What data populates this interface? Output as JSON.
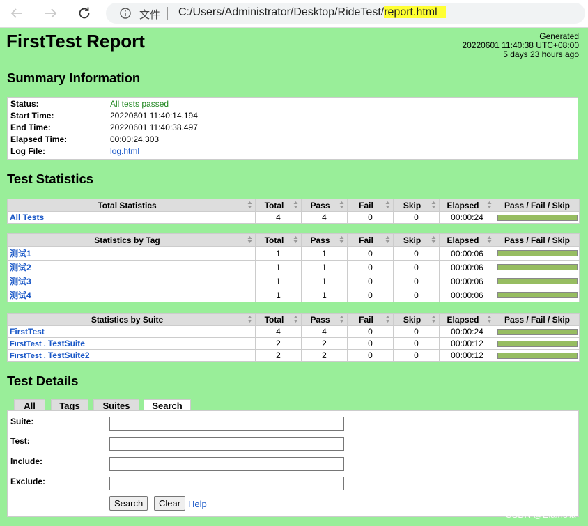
{
  "browser": {
    "url_prefix": "文件",
    "url_path": "C:/Users/Administrator/Desktop/RideTest/",
    "url_file": "report.html"
  },
  "header": {
    "title": "FirstTest Report",
    "generated_label": "Generated",
    "generated_time": "20220601 11:40:38 UTC+08:00",
    "generated_ago": "5 days 23 hours ago"
  },
  "summary": {
    "heading": "Summary Information",
    "rows": [
      {
        "label": "Status:",
        "value": "All tests passed"
      },
      {
        "label": "Start Time:",
        "value": "20220601 11:40:14.194"
      },
      {
        "label": "End Time:",
        "value": "20220601 11:40:38.497"
      },
      {
        "label": "Elapsed Time:",
        "value": "00:00:24.303"
      },
      {
        "label": "Log File:",
        "value": "log.html"
      }
    ]
  },
  "statistics": {
    "heading": "Test Statistics",
    "columns": [
      "Total",
      "Pass",
      "Fail",
      "Skip",
      "Elapsed",
      "Pass / Fail / Skip"
    ],
    "total": {
      "header": "Total Statistics",
      "rows": [
        {
          "name": "All Tests",
          "total": "4",
          "pass": "4",
          "fail": "0",
          "skip": "0",
          "elapsed": "00:00:24",
          "pass_fraction": 1
        }
      ]
    },
    "tag": {
      "header": "Statistics by Tag",
      "rows": [
        {
          "name": "测试1",
          "total": "1",
          "pass": "1",
          "fail": "0",
          "skip": "0",
          "elapsed": "00:00:06",
          "pass_fraction": 1
        },
        {
          "name": "测试2",
          "total": "1",
          "pass": "1",
          "fail": "0",
          "skip": "0",
          "elapsed": "00:00:06",
          "pass_fraction": 1
        },
        {
          "name": "测试3",
          "total": "1",
          "pass": "1",
          "fail": "0",
          "skip": "0",
          "elapsed": "00:00:06",
          "pass_fraction": 1
        },
        {
          "name": "测试4",
          "total": "1",
          "pass": "1",
          "fail": "0",
          "skip": "0",
          "elapsed": "00:00:06",
          "pass_fraction": 1
        }
      ]
    },
    "suite": {
      "header": "Statistics by Suite",
      "rows": [
        {
          "name": "FirstTest",
          "total": "4",
          "pass": "4",
          "fail": "0",
          "skip": "0",
          "elapsed": "00:00:24",
          "pass_fraction": 1
        },
        {
          "name_prefix": "FirstTest . ",
          "name": "TestSuite",
          "total": "2",
          "pass": "2",
          "fail": "0",
          "skip": "0",
          "elapsed": "00:00:12",
          "pass_fraction": 1
        },
        {
          "name_prefix": "FirstTest . ",
          "name": "TestSuite2",
          "total": "2",
          "pass": "2",
          "fail": "0",
          "skip": "0",
          "elapsed": "00:00:12",
          "pass_fraction": 1
        }
      ]
    }
  },
  "details": {
    "heading": "Test Details",
    "tabs": [
      "All",
      "Tags",
      "Suites",
      "Search"
    ],
    "active_tab": "Search",
    "fields": [
      {
        "label": "Suite:",
        "value": ""
      },
      {
        "label": "Test:",
        "value": ""
      },
      {
        "label": "Include:",
        "value": ""
      },
      {
        "label": "Exclude:",
        "value": ""
      }
    ],
    "search_button": "Search",
    "clear_button": "Clear",
    "help_link": "Help"
  },
  "watermark": "CSDN @Elaine猿",
  "colors": {
    "background": "#99ee99",
    "pass_bar": "#97bd61",
    "link": "#1a58c7",
    "highlight": "#ffff33"
  }
}
